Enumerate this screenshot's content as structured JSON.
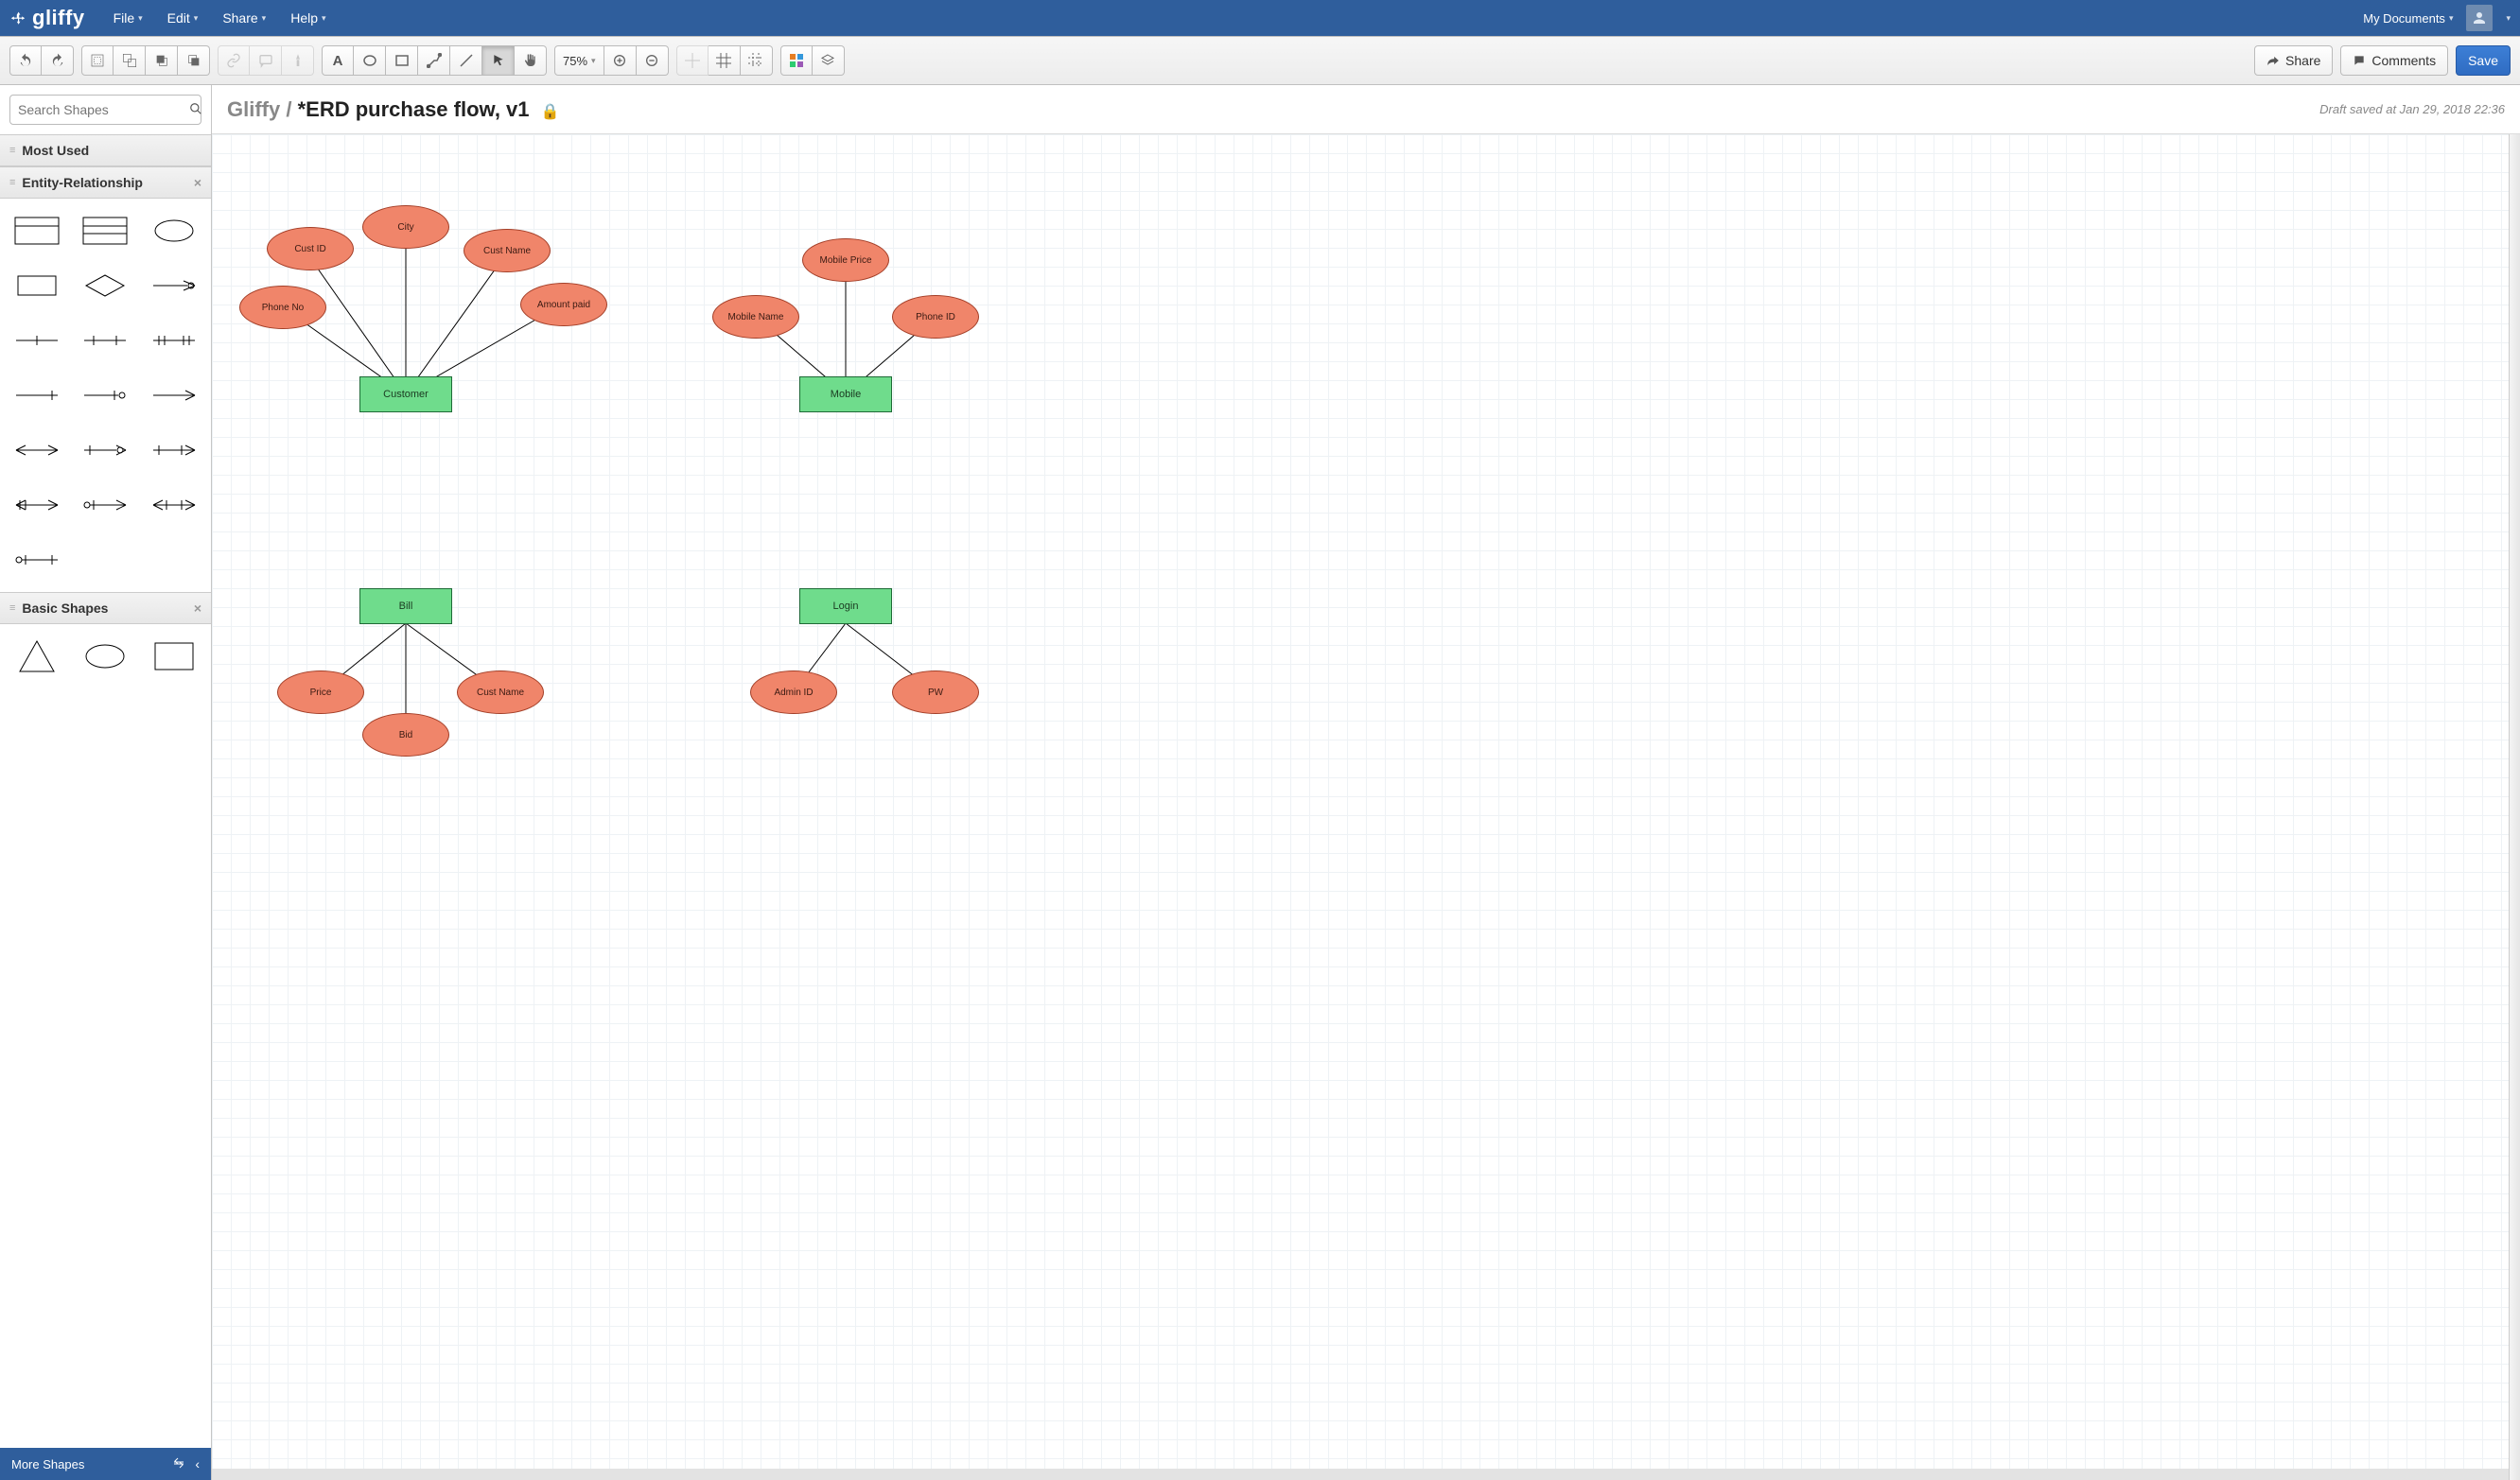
{
  "app": {
    "name": "gliffy"
  },
  "menus": [
    "File",
    "Edit",
    "Share",
    "Help"
  ],
  "rightMenu": {
    "myDocs": "My Documents"
  },
  "toolbar": {
    "zoom": "75%",
    "share": "Share",
    "comments": "Comments",
    "save": "Save"
  },
  "sidebar": {
    "searchPlaceholder": "Search Shapes",
    "sections": {
      "mostUsed": "Most Used",
      "er": "Entity-Relationship",
      "basic": "Basic Shapes"
    },
    "footer": "More Shapes"
  },
  "document": {
    "breadcrumbRoot": "Gliffy",
    "title": "*ERD purchase flow, v1",
    "draftStatus": "Draft saved at Jan 29, 2018 22:36"
  },
  "diagram": {
    "entities": {
      "customer": "Customer",
      "mobile": "Mobile",
      "bill": "Bill",
      "login": "Login"
    },
    "attributes": {
      "phoneNo": "Phone No",
      "custId": "Cust ID",
      "city": "City",
      "custName": "Cust Name",
      "amountPaid": "Amount paid",
      "mobileName": "Mobile Name",
      "mobilePrice": "Mobile Price",
      "phoneId": "Phone ID",
      "price": "Price",
      "bid": "Bid",
      "custName2": "Cust Name",
      "adminId": "Admin ID",
      "pw": "PW"
    }
  }
}
